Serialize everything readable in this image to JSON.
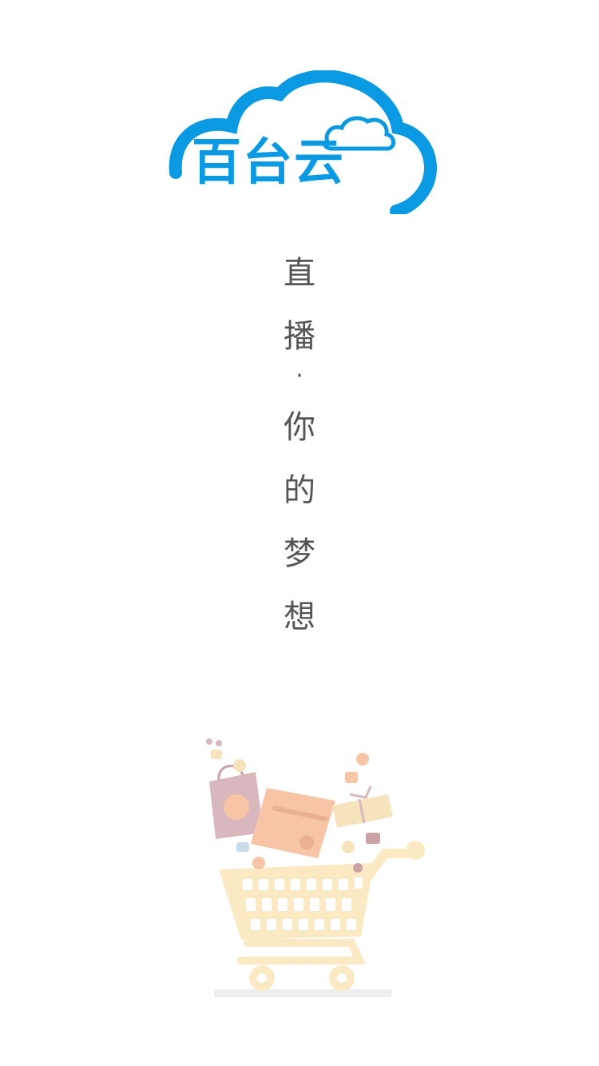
{
  "logo": {
    "text": "百台云",
    "icon": "cloud-logo-icon",
    "color": "#0a9ae3"
  },
  "slogan": {
    "chars": [
      "直",
      "播",
      "·",
      "你",
      "的",
      "梦",
      "想"
    ],
    "color": "#555555"
  },
  "illustration": {
    "icon": "shopping-cart-icon",
    "colors": {
      "cart": "#fbe9c4",
      "bag": "#d9b8bd",
      "card": "#f7c4a6",
      "box": "#f6e3bc"
    }
  }
}
